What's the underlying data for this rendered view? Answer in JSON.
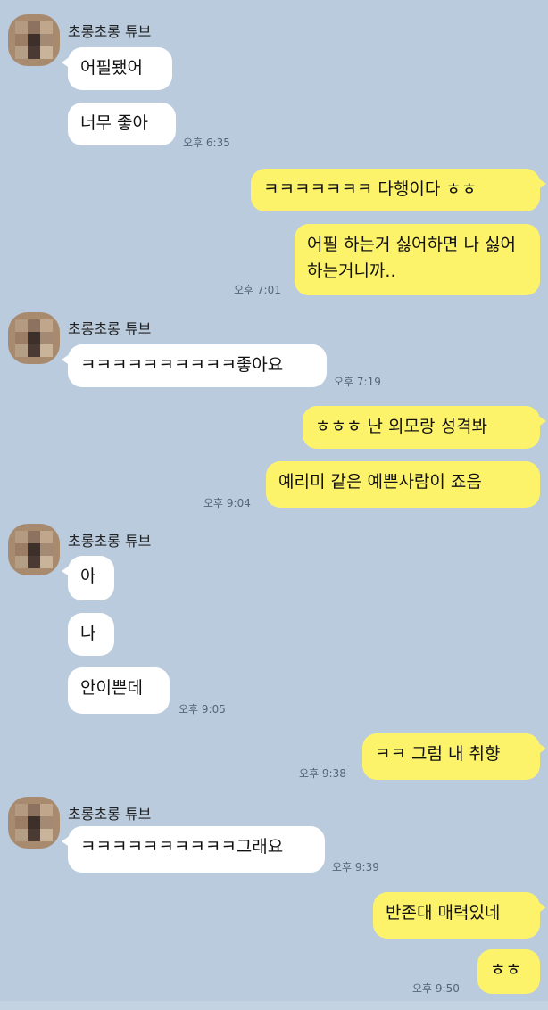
{
  "colors": {
    "background": "#b9cbdc",
    "incoming_bubble": "#ffffff",
    "outgoing_bubble": "#fdf36b"
  },
  "messages": [
    {
      "sender": "초롱초롱 튜브",
      "text": "어필됐어"
    },
    {
      "text": "너무 좋아",
      "time": "오후 6:35"
    },
    {
      "text": "ㅋㅋㅋㅋㅋㅋㅋ 다행이다 ㅎㅎ"
    },
    {
      "text": "어필 하는거 싫어하면 나 싫어하는거니까..",
      "time": "오후 7:01"
    },
    {
      "sender": "초롱초롱 튜브",
      "text": "ㅋㅋㅋㅋㅋㅋㅋㅋㅋㅋ좋아요",
      "time": "오후 7:19"
    },
    {
      "text": "ㅎㅎㅎ 난 외모랑 성격봐"
    },
    {
      "text": "예리미 같은 예쁜사람이 죠음",
      "time": "오후 9:04"
    },
    {
      "sender": "초롱초롱 튜브",
      "text": "아"
    },
    {
      "text": "나"
    },
    {
      "text": "안이쁜데",
      "time": "오후 9:05"
    },
    {
      "text": "ㅋㅋ 그럼 내 취향",
      "time": "오후 9:38"
    },
    {
      "sender": "초롱초롱 튜브",
      "text": "ㅋㅋㅋㅋㅋㅋㅋㅋㅋㅋ그래요",
      "time": "오후 9:39"
    },
    {
      "text": "반존대 매력있네"
    },
    {
      "text": "ㅎㅎ",
      "time": "오후 9:50"
    }
  ]
}
